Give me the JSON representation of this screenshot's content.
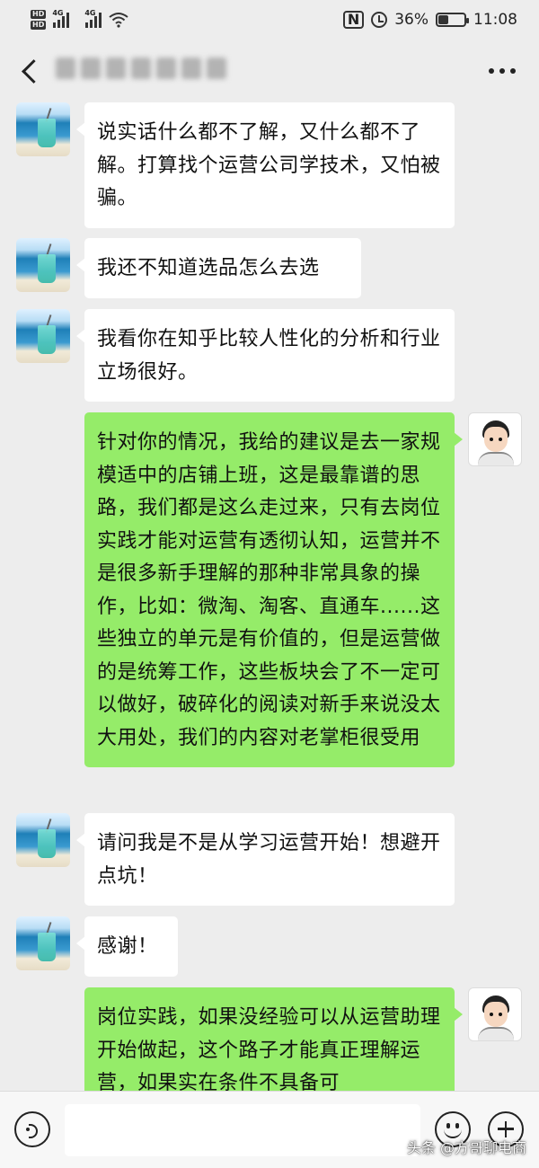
{
  "status_bar": {
    "hd1": "HD",
    "hd2": "HD",
    "net1": "4G",
    "net2": "4G",
    "battery_percent": "36%",
    "battery_level": 0.36,
    "time": "11:08"
  },
  "header": {
    "back_icon": "chevron-left-icon",
    "more_icon": "more-dots-icon"
  },
  "messages": [
    {
      "sender": "other",
      "text": "说实话什么都不了解，又什么都不了解。打算找个运营公司学技术，又怕被骗。"
    },
    {
      "sender": "other",
      "text": "我还不知道选品怎么去选"
    },
    {
      "sender": "other",
      "text": "我看你在知乎比较人性化的分析和行业立场很好。"
    },
    {
      "sender": "me",
      "text": "针对你的情况，我给的建议是去一家规模适中的店铺上班，这是最靠谱的思路，我们都是这么走过来，只有去岗位实践才能对运营有透彻认知，运营并不是很多新手理解的那种非常具象的操作，比如：微淘、淘客、直通车......这些独立的单元是有价值的，但是运营做的是统筹工作，这些板块会了不一定可以做好，破碎化的阅读对新手来说没太大用处，我们的内容对老掌柜很受用"
    },
    {
      "sender": "other",
      "text": "请问我是不是从学习运营开始！想避开点坑！"
    },
    {
      "sender": "other",
      "text": "感谢！"
    },
    {
      "sender": "me",
      "text": "岗位实践，如果没经验可以从运营助理开始做起，这个路子才能真正理解运营，如果实在条件不具备可"
    }
  ],
  "input_bar": {
    "voice_icon": "voice-icon",
    "text_value": "",
    "emoji_icon": "emoji-icon",
    "plus_icon": "plus-icon"
  },
  "watermark": "头条 @方哥聊电商",
  "colors": {
    "background": "#ededed",
    "bubble_other": "#ffffff",
    "bubble_me": "#95ec69"
  }
}
